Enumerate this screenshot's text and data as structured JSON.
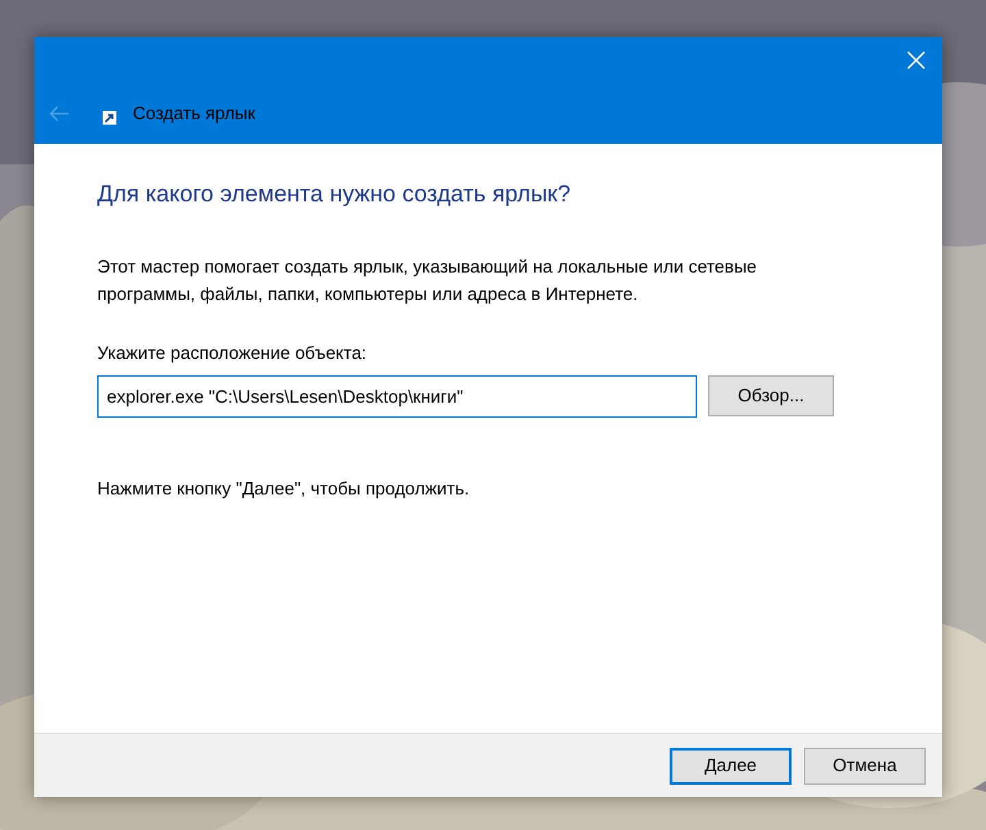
{
  "window": {
    "title": "Создать ярлык",
    "back_button": {
      "disabled": true
    }
  },
  "heading": "Для какого элемента нужно создать ярлык?",
  "description": "Этот мастер помогает создать ярлык, указывающий на локальные или сетевые программы, файлы, папки, компьютеры или адреса в Интернете.",
  "location": {
    "label": "Укажите расположение объекта:",
    "value": "explorer.exe \"C:\\Users\\Lesen\\Desktop\\книги\"",
    "browse_button": "Обзор..."
  },
  "hint": "Нажмите кнопку \"Далее\", чтобы продолжить.",
  "buttons": [
    {
      "label": "Далее",
      "default": true
    },
    {
      "label": "Отмена",
      "default": false
    }
  ]
}
